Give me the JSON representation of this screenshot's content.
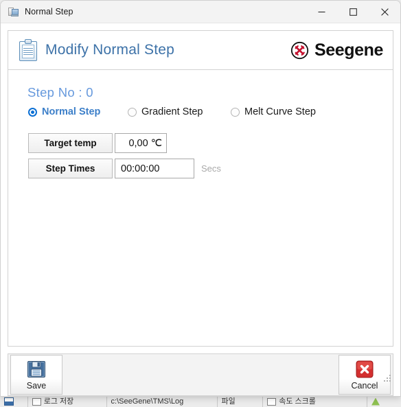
{
  "window": {
    "title": "Normal Step",
    "app_icon": "window-app-icon",
    "controls": [
      {
        "name": "minimize",
        "glyph": "minimize-icon"
      },
      {
        "name": "maximize",
        "glyph": "maximize-icon"
      },
      {
        "name": "close",
        "glyph": "close-icon"
      }
    ]
  },
  "header": {
    "icon": "clipboard-icon",
    "title": "Modify Normal Step",
    "brand": {
      "logo_mark": "seegene-circle-mark",
      "name": "Seegene",
      "mark_color": "#c4122f",
      "text_color": "#111111"
    },
    "title_color": "#3d72a8"
  },
  "content": {
    "step_no_label": "Step No : 0",
    "step_no_color": "#6699dd",
    "step_type": {
      "selected": "Normal Step",
      "options": [
        {
          "label": "Normal Step",
          "selected": true
        },
        {
          "label": "Gradient Step",
          "selected": false
        },
        {
          "label": "Melt Curve Step",
          "selected": false
        }
      ],
      "selected_color": "#3c7fc9"
    },
    "fields": [
      {
        "label": "Target temp",
        "value": "0,00 ℃",
        "suffix": ""
      },
      {
        "label": "Step Times",
        "value": "00:00:00",
        "suffix": "Secs"
      }
    ]
  },
  "footer": {
    "save": {
      "label": "Save",
      "icon": "floppy-disk-icon"
    },
    "cancel": {
      "label": "Cancel",
      "icon": "red-x-icon"
    }
  },
  "backdrop": {
    "status_cells": [
      "로그 저장",
      "c:\\SeeGene\\TMS\\Log",
      "파일",
      "속도 스크롤"
    ]
  }
}
